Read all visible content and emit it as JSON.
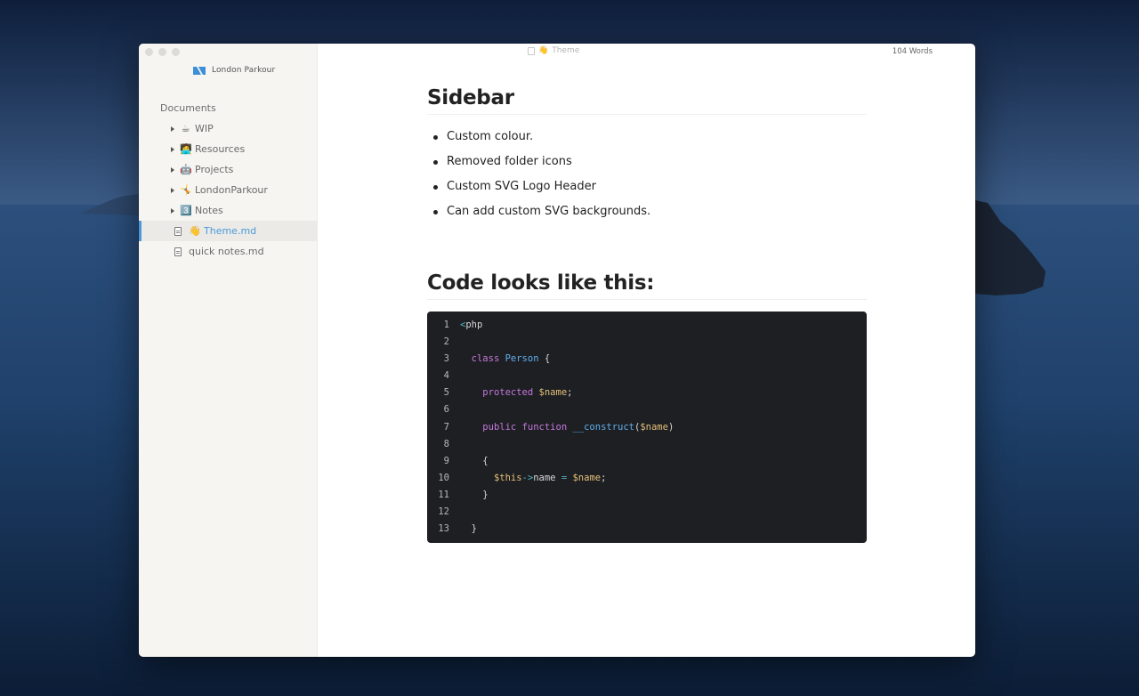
{
  "window": {
    "title": "Theme",
    "title_emoji": "👋",
    "word_count": "104 Words"
  },
  "sidebar": {
    "logo_text": "London Parkour",
    "section_label": "Documents",
    "items": [
      {
        "type": "folder",
        "emoji": "☕",
        "label": "WIP"
      },
      {
        "type": "folder",
        "emoji": "🧑‍💻",
        "label": "Resources"
      },
      {
        "type": "folder",
        "emoji": "🤖",
        "label": "Projects"
      },
      {
        "type": "folder",
        "emoji": "🤸",
        "label": "LondonParkour"
      },
      {
        "type": "folder",
        "emoji": "3️⃣",
        "label": "Notes"
      },
      {
        "type": "file",
        "emoji": "👋",
        "label": "Theme.md",
        "active": true
      },
      {
        "type": "file",
        "emoji": "",
        "label": "quick notes.md"
      }
    ],
    "accent_color": "#4a9ad9"
  },
  "content": {
    "heading1": "Sidebar",
    "bullets": [
      "Custom colour.",
      "Removed folder icons",
      "Custom SVG Logo Header",
      "Can add custom SVG backgrounds."
    ],
    "heading2": "Code looks like this:",
    "code": {
      "line_numbers": [
        "1",
        "2",
        "3",
        "4",
        "5",
        "6",
        "7",
        "8",
        "9",
        "10",
        "11",
        "12",
        "13"
      ],
      "lines": [
        "<php",
        "",
        "  class Person {",
        "",
        "    protected $name;",
        "",
        "    public function __construct($name)",
        "",
        "    {",
        "      $this->name = $name;",
        "    }",
        "",
        "  }"
      ],
      "tokens": {
        "l1": {
          "a": "<",
          "b": "php"
        },
        "l3": {
          "kw": "class",
          "cls": "Person",
          "rest": " {"
        },
        "l5": {
          "kw": "protected",
          "var": "$name",
          "rest": ";"
        },
        "l7": {
          "kw1": "public",
          "kw2": "function",
          "fn": "__construct",
          "p1": "(",
          "var": "$name",
          "p2": ")"
        },
        "l9": {
          "rest": "{"
        },
        "l10": {
          "var1": "$this",
          "op": "->",
          "prop": "name",
          "eq": " = ",
          "var2": "$name",
          "semi": ";"
        },
        "l11": {
          "rest": "}"
        },
        "l13": {
          "rest": "}"
        }
      }
    }
  }
}
